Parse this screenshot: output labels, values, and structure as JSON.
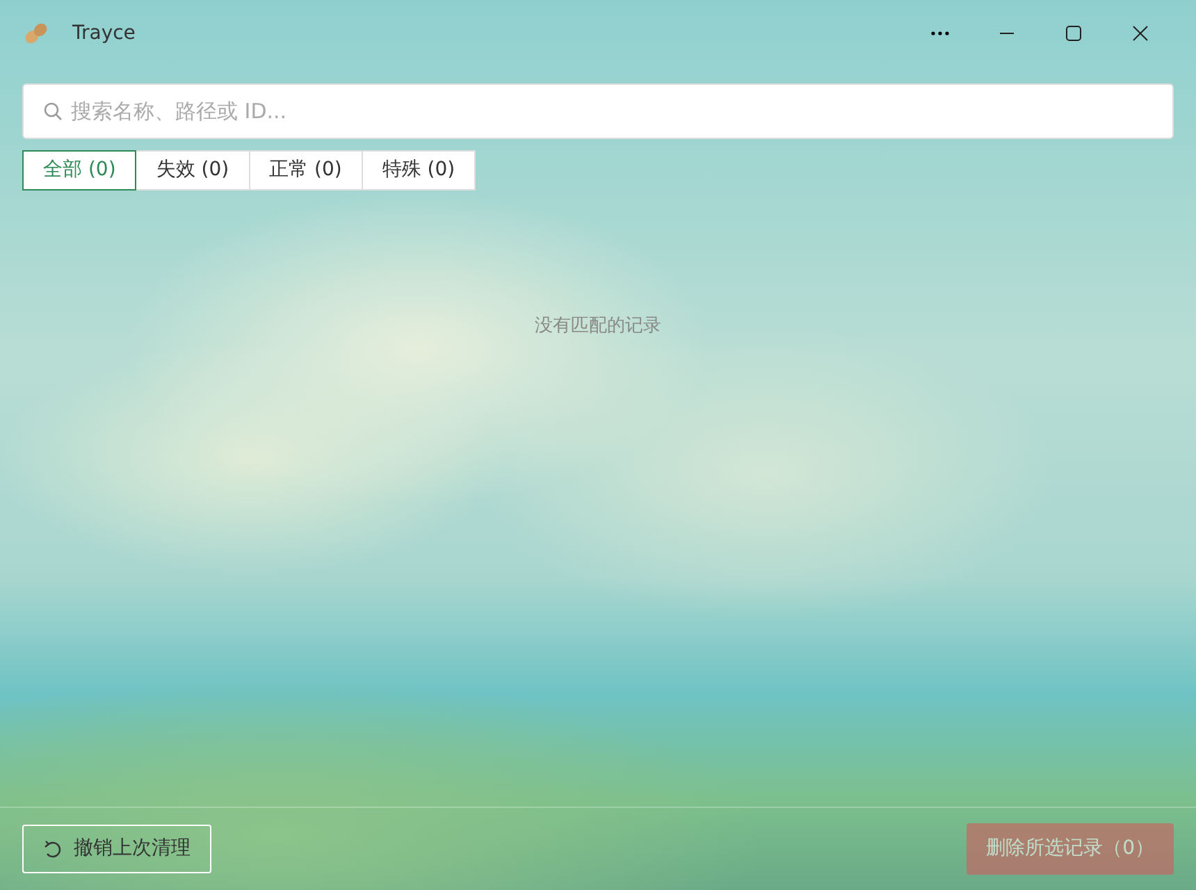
{
  "window": {
    "title": "Trayce"
  },
  "search": {
    "placeholder": "搜索名称、路径或 ID..."
  },
  "filters": [
    {
      "label": "全部 (0)",
      "selected": true
    },
    {
      "label": "失效 (0)",
      "selected": false
    },
    {
      "label": "正常 (0)",
      "selected": false
    },
    {
      "label": "特殊 (0)",
      "selected": false
    }
  ],
  "empty_message": "没有匹配的记录",
  "footer": {
    "undo_button": {
      "label": "撤销上次清理",
      "disabled": false
    },
    "delete_button": {
      "label": "删除所选记录（0）",
      "disabled": true
    }
  }
}
